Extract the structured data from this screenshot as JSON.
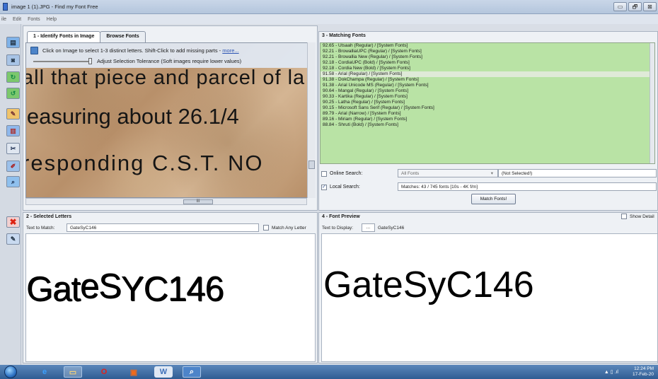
{
  "window": {
    "title": "image 1 (1).JPG - Find my Font Free",
    "buttons": [
      "▭",
      "🗗",
      "⊠"
    ]
  },
  "menu": [
    "ile",
    "Edit",
    "Fonts",
    "Help"
  ],
  "toolbar_icons": [
    "image-icon",
    "camera-icon",
    "rotate-icon",
    "refresh-icon",
    "pen-icon",
    "chart-icon",
    "cut-icon",
    "brush-icon",
    "zoom-icon"
  ],
  "panel1": {
    "tabs": [
      "1 - Identify Fonts in Image",
      "Browse Fonts"
    ],
    "instruction": "Click on Image to select 1-3 distinct letters. Shift-Click to add missing parts -",
    "instruction_link": "more...",
    "slider_label": "Adjust Selection Tolerance (Soft images require lower values)",
    "image_lines": [
      "all that piece and parcel of la",
      "leasuring about 26.1/4",
      "responding  C.S.T.  NO"
    ],
    "hscroll_label": "III"
  },
  "panel3": {
    "header": "3 - Matching Fonts",
    "fonts": [
      "92.65 - Utsaah (Regular) / [System Fonts]",
      "92.21 - BrowalliaUPC (Regular) / [System Fonts]",
      "92.21 - Browallia New (Regular) / [System Fonts]",
      "92.18 - CordiaUPC (Bold) / [System Fonts]",
      "92.18 - Cordia New (Bold) / [System Fonts]",
      "91.58 - Arial (Regular) / [System Fonts]",
      "91.38 - DokChampa (Regular) / [System Fonts]",
      "91.38 - Arial Unicode MS (Regular) / [System Fonts]",
      "90.64 - Mangal (Regular) / [System Fonts]",
      "90.33 - Kartika (Regular) / [System Fonts]",
      "90.25 - Latha (Regular) / [System Fonts]",
      "90.15 - Microsoft Sans Serif (Regular) / [System Fonts]",
      "89.79 - Arial (Narrow) / [System Fonts]",
      "89.16 - Miriam (Regular) / [System Fonts]",
      "88.84 - Shruti (Bold) / [System Fonts]"
    ],
    "online_search_label": "Online Search:",
    "online_combo": "All Fonts",
    "online_field": "(Not Selected!)",
    "local_search_label": "Local Search:",
    "local_field": "Matches: 43 / 745 fonts [10s - 4K f/m]",
    "match_button": "Match Fonts!"
  },
  "panel2": {
    "header": "2 - Selected Letters",
    "text_to_match_label": "Text to Match:",
    "text_to_match_value": "GateSyC146",
    "match_any_letter": "Match Any Letter",
    "letters": {
      "a": "Gat",
      "b": "eS",
      "c": "YC146"
    }
  },
  "panel4": {
    "header": "4 - Font Preview",
    "show_details": "Show Detail",
    "text_to_display_label": "Text to Display:",
    "ellipsis_button": "...",
    "text_to_display_value": "GateSyC146",
    "preview_text": "GateSyC146"
  },
  "taskbar": {
    "time": "12:24 PM",
    "date": "17-Feb-20",
    "tray": "▲ ▯ .ıl"
  }
}
